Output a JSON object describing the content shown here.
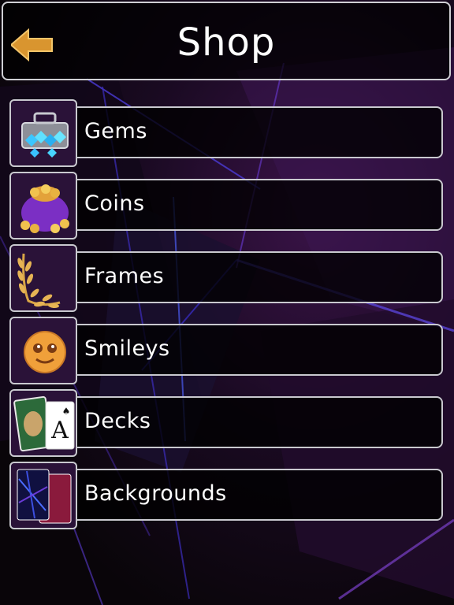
{
  "header": {
    "title": "Shop",
    "back_icon": "back-arrow-icon",
    "accent_color": "#e3a23a"
  },
  "menu": [
    {
      "label": "Gems",
      "icon": "gem-case-icon"
    },
    {
      "label": "Coins",
      "icon": "coin-bag-icon"
    },
    {
      "label": "Frames",
      "icon": "laurel-frame-icon"
    },
    {
      "label": "Smileys",
      "icon": "smiley-icon"
    },
    {
      "label": "Decks",
      "icon": "card-deck-icon"
    },
    {
      "label": "Backgrounds",
      "icon": "backgrounds-icon"
    }
  ]
}
